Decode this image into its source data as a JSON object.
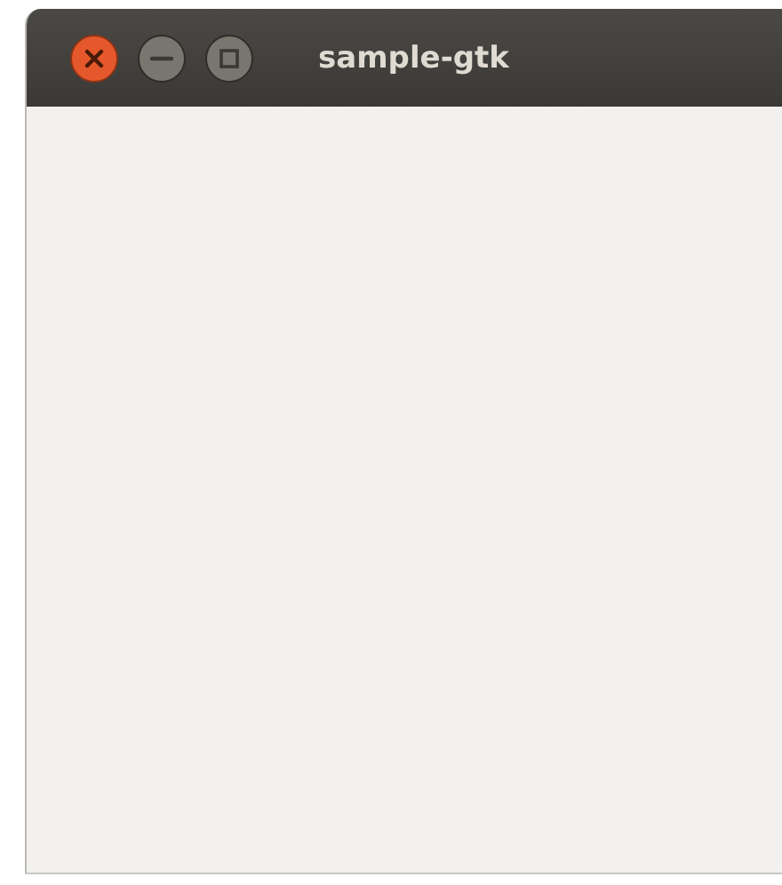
{
  "window": {
    "title": "sample-gtk"
  }
}
